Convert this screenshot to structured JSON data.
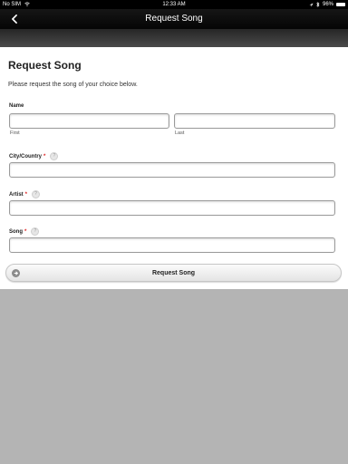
{
  "status_bar": {
    "carrier": "No SIM",
    "time": "12:33 AM",
    "battery_percent": "96%",
    "battery_level": 0.96
  },
  "nav": {
    "title": "Request Song",
    "back_icon": "chevron-left-icon"
  },
  "form": {
    "title": "Request Song",
    "description": "Please request the song of your choice below.",
    "name": {
      "label": "Name",
      "first_label": "First",
      "last_label": "Last",
      "first_value": "",
      "last_value": ""
    },
    "city": {
      "label": "City/Country",
      "required": "*",
      "help": "?",
      "value": ""
    },
    "artist": {
      "label": "Artist",
      "required": "*",
      "help": "?",
      "value": ""
    },
    "song": {
      "label": "Song",
      "required": "*",
      "help": "?",
      "value": ""
    },
    "submit_label": "Request Song"
  },
  "colors": {
    "required": "#dd2222",
    "nav_bg": "#0b0b0b",
    "bottom_bg": "#b4b4b4"
  }
}
